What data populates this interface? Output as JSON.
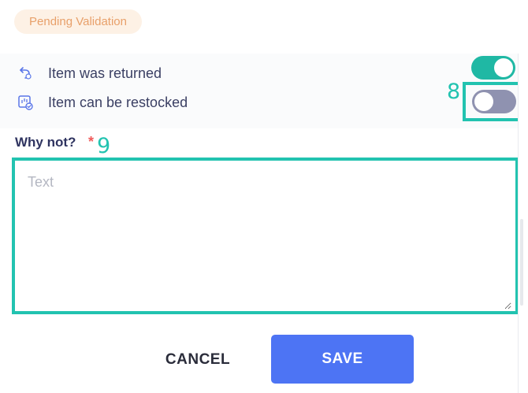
{
  "status": {
    "label": "Pending Validation",
    "bg_color": "#fdf1e5",
    "text_color": "#e8a06a"
  },
  "options": [
    {
      "icon": "return-arrow-icon",
      "label": "Item was returned",
      "toggle_state": "on"
    },
    {
      "icon": "restock-box-check-icon",
      "label": "Item can be restocked",
      "toggle_state": "off"
    }
  ],
  "reason": {
    "label": "Why not?",
    "required_marker": "*",
    "placeholder": "Text",
    "value": ""
  },
  "annotations": {
    "toggle_marker": "8",
    "reason_marker": "9",
    "color": "#22c3b0"
  },
  "actions": {
    "cancel_label": "CANCEL",
    "save_label": "SAVE",
    "save_color": "#4d74f4"
  },
  "colors": {
    "toggle_on": "#1fb8a4",
    "toggle_off": "#8f92b0",
    "text": "#3a3f63",
    "required": "#f05b5b"
  }
}
